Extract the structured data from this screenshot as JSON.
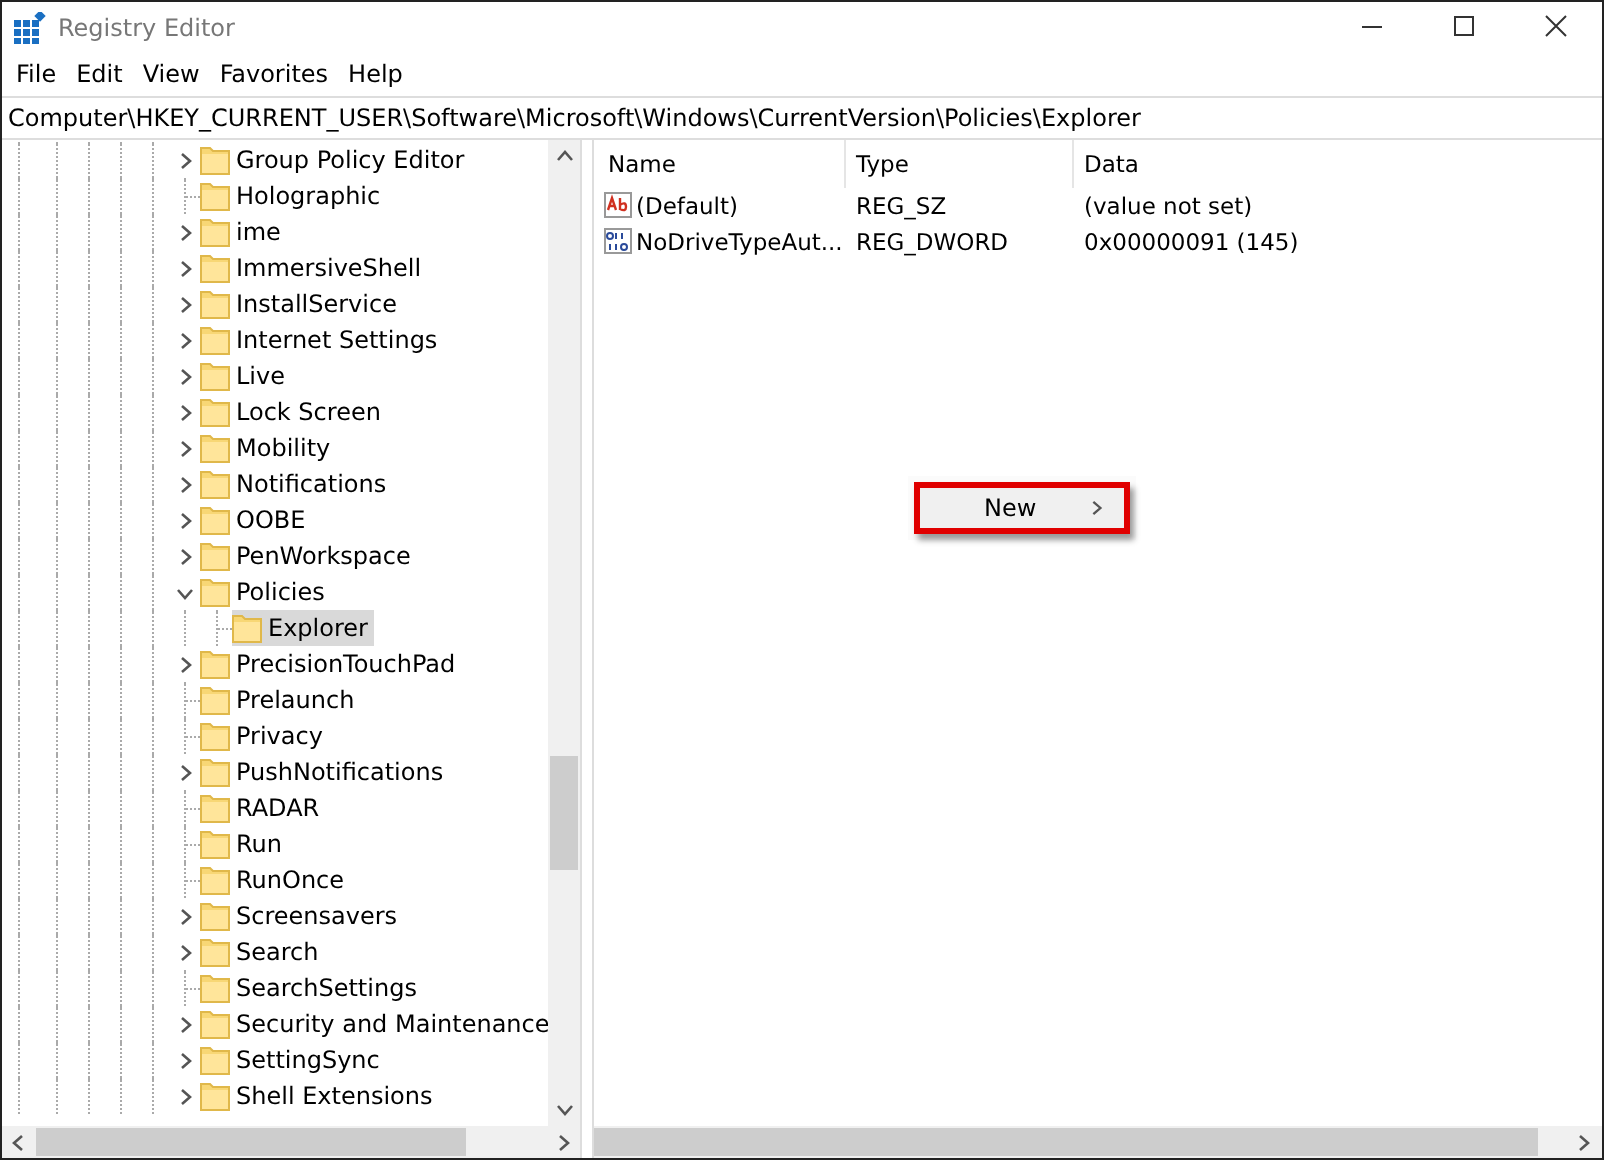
{
  "window": {
    "title": "Registry Editor"
  },
  "menu": [
    "File",
    "Edit",
    "View",
    "Favorites",
    "Help"
  ],
  "address": "Computer\\HKEY_CURRENT_USER\\Software\\Microsoft\\Windows\\CurrentVersion\\Policies\\Explorer",
  "tree": [
    {
      "label": "Group Policy Editor",
      "kind": "branch",
      "expanded": false,
      "selected": false
    },
    {
      "label": "Holographic",
      "kind": "leaf",
      "selected": false
    },
    {
      "label": "ime",
      "kind": "branch",
      "expanded": false,
      "selected": false
    },
    {
      "label": "ImmersiveShell",
      "kind": "branch",
      "expanded": false,
      "selected": false
    },
    {
      "label": "InstallService",
      "kind": "branch",
      "expanded": false,
      "selected": false
    },
    {
      "label": "Internet Settings",
      "kind": "branch",
      "expanded": false,
      "selected": false
    },
    {
      "label": "Live",
      "kind": "branch",
      "expanded": false,
      "selected": false
    },
    {
      "label": "Lock Screen",
      "kind": "branch",
      "expanded": false,
      "selected": false
    },
    {
      "label": "Mobility",
      "kind": "branch",
      "expanded": false,
      "selected": false
    },
    {
      "label": "Notifications",
      "kind": "branch",
      "expanded": false,
      "selected": false
    },
    {
      "label": "OOBE",
      "kind": "branch",
      "expanded": false,
      "selected": false
    },
    {
      "label": "PenWorkspace",
      "kind": "branch",
      "expanded": false,
      "selected": false
    },
    {
      "label": "Policies",
      "kind": "branch",
      "expanded": true,
      "selected": false,
      "children": [
        {
          "label": "Explorer",
          "kind": "leaf",
          "selected": true
        }
      ]
    },
    {
      "label": "PrecisionTouchPad",
      "kind": "branch",
      "expanded": false,
      "selected": false
    },
    {
      "label": "Prelaunch",
      "kind": "leaf",
      "selected": false
    },
    {
      "label": "Privacy",
      "kind": "leaf",
      "selected": false
    },
    {
      "label": "PushNotifications",
      "kind": "branch",
      "expanded": false,
      "selected": false
    },
    {
      "label": "RADAR",
      "kind": "leaf",
      "selected": false
    },
    {
      "label": "Run",
      "kind": "leaf",
      "selected": false
    },
    {
      "label": "RunOnce",
      "kind": "leaf",
      "selected": false
    },
    {
      "label": "Screensavers",
      "kind": "branch",
      "expanded": false,
      "selected": false
    },
    {
      "label": "Search",
      "kind": "branch",
      "expanded": false,
      "selected": false
    },
    {
      "label": "SearchSettings",
      "kind": "leaf",
      "selected": false
    },
    {
      "label": "Security and Maintenance",
      "kind": "branch",
      "expanded": false,
      "selected": false
    },
    {
      "label": "SettingSync",
      "kind": "branch",
      "expanded": false,
      "selected": false
    },
    {
      "label": "Shell Extensions",
      "kind": "branch",
      "expanded": false,
      "selected": false
    }
  ],
  "values": {
    "columns": [
      "Name",
      "Type",
      "Data"
    ],
    "rows": [
      {
        "kind": "string",
        "name": "(Default)",
        "type": "REG_SZ",
        "data": "(value not set)"
      },
      {
        "kind": "binary",
        "name": "NoDriveTypeAut...",
        "type": "REG_DWORD",
        "data": "0x00000091 (145)"
      }
    ]
  },
  "context_menu": {
    "items": [
      {
        "label": "New",
        "highlighted": true
      }
    ]
  }
}
